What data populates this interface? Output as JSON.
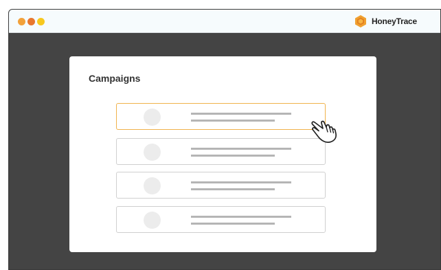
{
  "app": {
    "brand_name": "HoneyTrace",
    "window_controls": [
      {
        "name": "close",
        "color": "#f2a13a"
      },
      {
        "name": "minimize",
        "color": "#e8772e"
      },
      {
        "name": "zoom",
        "color": "#f7c81e"
      }
    ],
    "brand_color": "#f0a030"
  },
  "campaigns": {
    "title": "Campaigns",
    "selected_index": 0,
    "items": [
      {
        "icon": "avatar-placeholder"
      },
      {
        "icon": "avatar-placeholder"
      },
      {
        "icon": "avatar-placeholder"
      },
      {
        "icon": "avatar-placeholder"
      }
    ]
  },
  "cursor": {
    "icon": "pointer-hand-icon"
  }
}
